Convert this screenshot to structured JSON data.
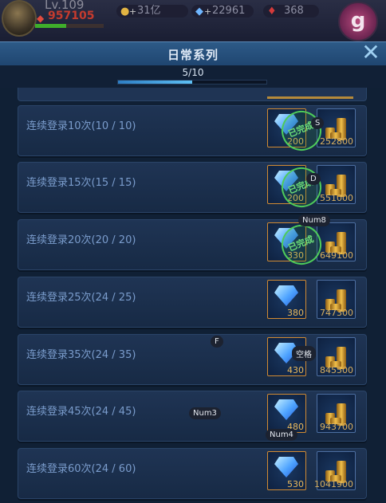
{
  "hud": {
    "level": "Lv.109",
    "hp": "957105",
    "hp_fraction": 0.45,
    "gold": "31亿",
    "diamonds": "22961",
    "rubies": "368",
    "menu_letter": "g"
  },
  "panel": {
    "title": "日常系列",
    "progress_text": "5/10",
    "progress_fraction": 0.5,
    "close_label": "✕"
  },
  "tasks": [
    {
      "label": "连续登录10次(10 / 10)",
      "gem_qty": "200",
      "gold_qty": "252800",
      "completed": true,
      "stamp": "已完成"
    },
    {
      "label": "连续登录15次(15 / 15)",
      "gem_qty": "200",
      "gold_qty": "551000",
      "completed": true,
      "stamp": "已完成"
    },
    {
      "label": "连续登录20次(20 / 20)",
      "gem_qty": "330",
      "gold_qty": "649100",
      "completed": true,
      "stamp": "已完成"
    },
    {
      "label": "连续登录25次(24 / 25)",
      "gem_qty": "380",
      "gold_qty": "747300",
      "completed": false
    },
    {
      "label": "连续登录35次(24 / 35)",
      "gem_qty": "430",
      "gold_qty": "845500",
      "completed": false
    },
    {
      "label": "连续登录45次(24 / 45)",
      "gem_qty": "480",
      "gold_qty": "943700",
      "completed": false
    },
    {
      "label": "连续登录60次(24 / 60)",
      "gem_qty": "530",
      "gold_qty": "1041900",
      "completed": false
    }
  ],
  "key_hints": {
    "s": "S",
    "d": "D",
    "num8": "Num8",
    "f": "F",
    "space": "空格",
    "num3": "Num3",
    "num4": "Num4"
  }
}
